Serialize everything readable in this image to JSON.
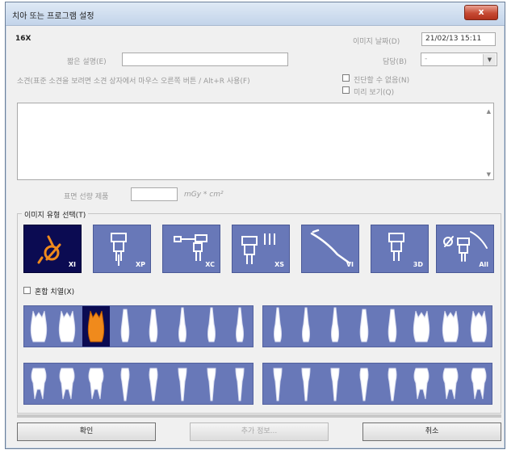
{
  "window": {
    "title": "치아 또는 프로그램 설정",
    "close_label": "x"
  },
  "header": {
    "id_label": "16X",
    "image_date_label": "이미지 날짜(D)",
    "image_date_value": "21/02/13 15:11",
    "desc_label": "짧은 설명(E)",
    "desc_value": "",
    "owner_label": "담당(B)",
    "owner_value": "-",
    "note_label": "소견(표준 소견을 보려면 소견 상자에서 마우스 오른쪽 버튼 / Alt+R 사용(F)",
    "no_diagnosis_label": "진단할 수 없음(N)",
    "preview_label": "미리 보기(Q)"
  },
  "dose": {
    "label": "표면 선량 제품",
    "value": "",
    "unit": "mGy * cm²"
  },
  "image_type": {
    "group_label": "이미지 유형 선택(T)",
    "types": [
      {
        "code": "XI",
        "icon": "intraoral-sensor-icon",
        "selected": true
      },
      {
        "code": "XP",
        "icon": "panoramic-icon",
        "selected": false
      },
      {
        "code": "XC",
        "icon": "cephalometric-icon",
        "selected": false
      },
      {
        "code": "XS",
        "icon": "scan-icon",
        "selected": false
      },
      {
        "code": "VI",
        "icon": "intraoral-camera-icon",
        "selected": false
      },
      {
        "code": "3D",
        "icon": "3d-volume-icon",
        "selected": false
      },
      {
        "code": "All",
        "icon": "all-types-icon",
        "selected": false
      }
    ],
    "mixed_dentition_label": "혼합 치열(X)"
  },
  "teeth": {
    "upper_right": [
      "18",
      "17",
      "16",
      "15",
      "14",
      "13",
      "12",
      "11"
    ],
    "upper_left": [
      "21",
      "22",
      "23",
      "24",
      "25",
      "26",
      "27",
      "28"
    ],
    "lower_right": [
      "48",
      "47",
      "46",
      "45",
      "44",
      "43",
      "42",
      "41"
    ],
    "lower_left": [
      "31",
      "32",
      "33",
      "34",
      "35",
      "36",
      "37",
      "38"
    ],
    "selected": "16"
  },
  "colors": {
    "panel": "#6878b8",
    "selected": "#0b0b52",
    "tooth": "#ffffff",
    "highlight": "#f08a1c"
  },
  "buttons": {
    "ok": "확인",
    "more_info": "추가 정보...",
    "cancel": "취소"
  }
}
